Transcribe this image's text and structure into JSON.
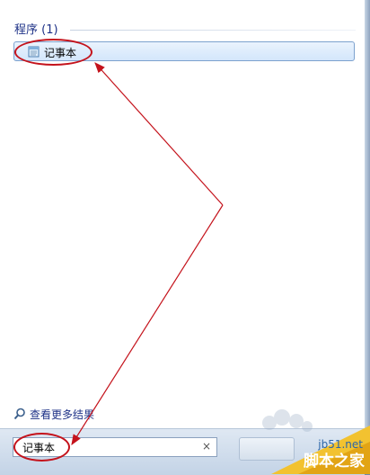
{
  "start_menu": {
    "group_header": "程序 (1)",
    "result_item": {
      "label": "记事本",
      "icon": "notepad-icon"
    },
    "more_results": {
      "label": "查看更多结果",
      "icon": "search-icon"
    },
    "search": {
      "value": "记事本",
      "clear_glyph": "×"
    }
  },
  "watermark": {
    "url": "jb51.net",
    "brand": "脚本之家"
  },
  "colors": {
    "annotation_red": "#c4121b",
    "header_blue": "#1e3287",
    "selection_border": "#7da2ce"
  }
}
